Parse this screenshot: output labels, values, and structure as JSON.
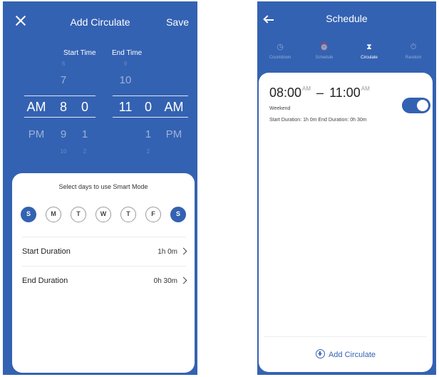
{
  "left": {
    "title": "Add Circulate",
    "save_label": "Save",
    "picker": {
      "start_label": "Start Time",
      "end_label": "End Time",
      "start": {
        "ampm": {
          "faint_above": "",
          "above": "",
          "selected": "AM",
          "below": "PM",
          "faint_below": ""
        },
        "hour": {
          "faint_above": "6",
          "above": "7",
          "selected": "8",
          "below": "9",
          "faint_below": "10"
        },
        "minute": {
          "faint_above": "",
          "above": "",
          "selected": "0",
          "below": "1",
          "faint_below": "2"
        }
      },
      "end": {
        "hour": {
          "faint_above": "9",
          "above": "10",
          "selected": "11",
          "below": "",
          "faint_below": ""
        },
        "minute": {
          "faint_above": "",
          "above": "",
          "selected": "0",
          "below": "1",
          "faint_below": "2"
        },
        "ampm": {
          "faint_above": "",
          "above": "",
          "selected": "AM",
          "below": "PM",
          "faint_below": ""
        }
      }
    },
    "card": {
      "heading": "Select days to use Smart Mode",
      "days": [
        {
          "letter": "S",
          "selected": true
        },
        {
          "letter": "M",
          "selected": false
        },
        {
          "letter": "T",
          "selected": false
        },
        {
          "letter": "W",
          "selected": false
        },
        {
          "letter": "T",
          "selected": false
        },
        {
          "letter": "F",
          "selected": false
        },
        {
          "letter": "S",
          "selected": true
        }
      ],
      "start_duration": {
        "label": "Start Duration",
        "value": "1h 0m"
      },
      "end_duration": {
        "label": "End Duration",
        "value": "0h 30m"
      }
    }
  },
  "right": {
    "title": "Schedule",
    "tabs": [
      {
        "label": "Countdown",
        "icon": "clock-icon",
        "glyph": "◷"
      },
      {
        "label": "Schedule",
        "icon": "alarm-clock-icon",
        "glyph": "⏰"
      },
      {
        "label": "Circulate",
        "icon": "hourglass-icon",
        "glyph": "⧗",
        "active": true
      },
      {
        "label": "Random",
        "icon": "stopwatch-icon",
        "glyph": "⏱"
      }
    ],
    "entry": {
      "start_time": "08:00",
      "start_ampm": "AM",
      "end_time": "11:00",
      "end_ampm": "AM",
      "dash": "–",
      "repeat": "Weekend",
      "durations": "Start Duration: 1h 0m    End Duration: 0h 30m",
      "enabled": true
    },
    "add_label": "Add Circulate"
  },
  "colors": {
    "primary": "#3462b2",
    "card": "#ffffff",
    "text": "#222222"
  }
}
